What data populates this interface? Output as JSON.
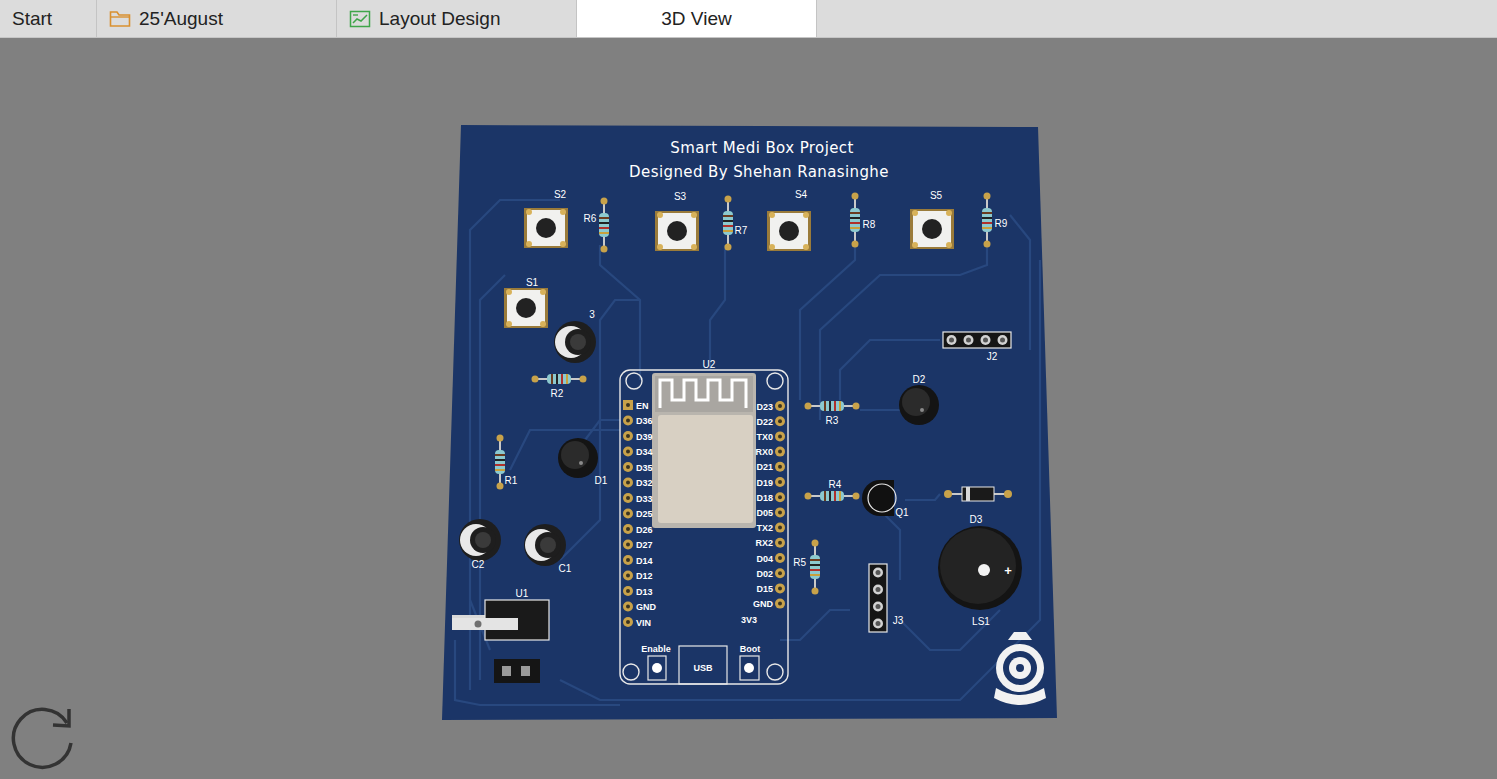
{
  "tabs": [
    {
      "label": "Start",
      "kind": "plain",
      "selected": false
    },
    {
      "label": "25'August",
      "kind": "folder",
      "selected": false
    },
    {
      "label": "Layout Design",
      "kind": "layout",
      "selected": false
    },
    {
      "label": "3D View",
      "kind": "plain",
      "selected": true
    }
  ],
  "board": {
    "title": "Smart Medi Box Project",
    "subtitle": "Designed By Shehan Ranasinghe"
  },
  "components": [
    {
      "kind": "button",
      "label": "S2"
    },
    {
      "kind": "resistor",
      "label": "R6"
    },
    {
      "kind": "button",
      "label": "S3"
    },
    {
      "kind": "resistor",
      "label": "R7"
    },
    {
      "kind": "button",
      "label": "S4"
    },
    {
      "kind": "resistor",
      "label": "R8"
    },
    {
      "kind": "button",
      "label": "S5"
    },
    {
      "kind": "resistor",
      "label": "R9"
    },
    {
      "kind": "button",
      "label": "S1"
    },
    {
      "kind": "capacitor",
      "label": "3"
    },
    {
      "kind": "resistor",
      "label": "R2"
    },
    {
      "kind": "header",
      "label": "J2"
    },
    {
      "kind": "led",
      "label": "D2"
    },
    {
      "kind": "resistor",
      "label": "R3"
    },
    {
      "kind": "resistor",
      "label": "R1"
    },
    {
      "kind": "led",
      "label": "D1"
    },
    {
      "kind": "resistor",
      "label": "R4"
    },
    {
      "kind": "transistor",
      "label": "Q1"
    },
    {
      "kind": "diode",
      "label": "D3"
    },
    {
      "kind": "capacitor",
      "label": "C2"
    },
    {
      "kind": "capacitor",
      "label": "C1"
    },
    {
      "kind": "resistor",
      "label": "R5"
    },
    {
      "kind": "header",
      "label": "J3"
    },
    {
      "kind": "buzzer",
      "label": "LS1",
      "mark": "+"
    },
    {
      "kind": "regulator",
      "label": "U1"
    },
    {
      "kind": "connector",
      "label": ""
    }
  ],
  "module": {
    "label": "U2",
    "left_pins": [
      "EN",
      "D36",
      "D39",
      "D34",
      "D35",
      "D32",
      "D33",
      "D25",
      "D26",
      "D27",
      "D14",
      "D12",
      "D13",
      "GND",
      "VIN"
    ],
    "right_pins": [
      "D23",
      "D22",
      "TX0",
      "RX0",
      "D21",
      "D19",
      "D18",
      "D05",
      "TX2",
      "RX2",
      "D04",
      "D02",
      "D15",
      "GND",
      "3V3"
    ],
    "buttons": [
      "Enable",
      "Boot"
    ],
    "usb": "USB"
  }
}
